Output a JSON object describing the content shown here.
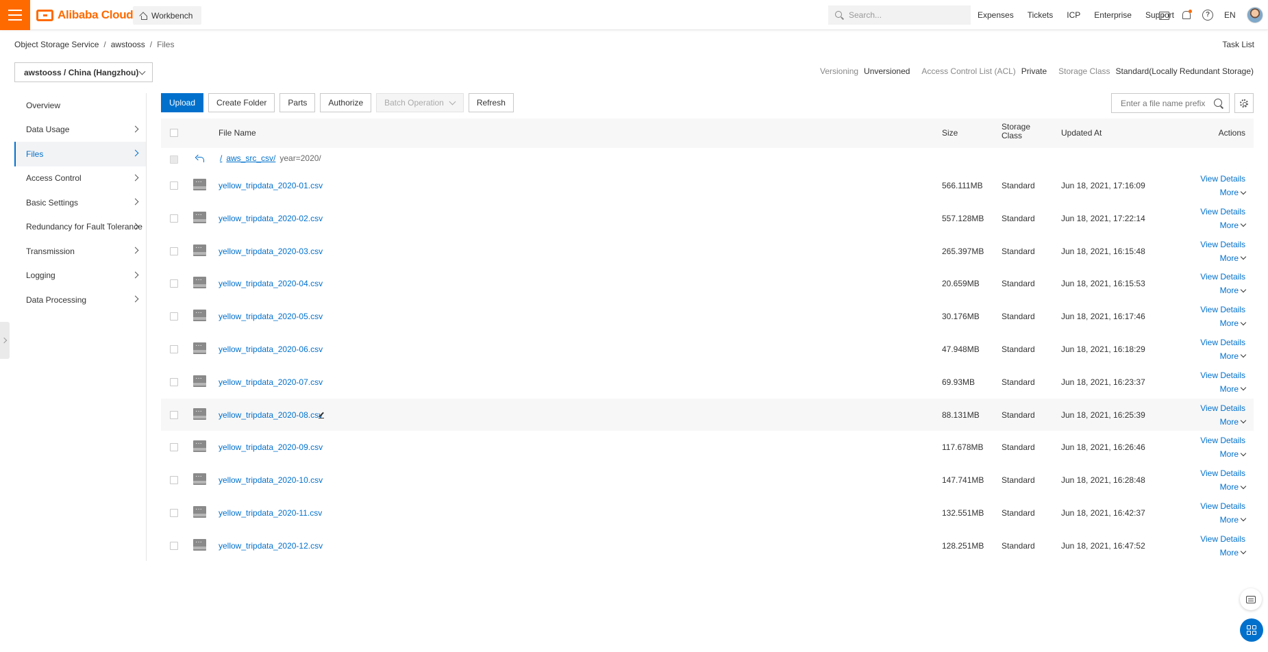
{
  "header": {
    "brand": "Alibaba Cloud",
    "workbench": "Workbench",
    "search_placeholder": "Search...",
    "links": [
      "Expenses",
      "Tickets",
      "ICP",
      "Enterprise",
      "Support"
    ],
    "help": "?",
    "lang": "EN"
  },
  "breadcrumb": [
    "Object Storage Service",
    "awstooss",
    "Files"
  ],
  "breadcrumb_sep": "/",
  "task_list": "Task List",
  "bucket": "awstooss / China (Hangzhou)",
  "meta": {
    "versioning_label": "Versioning",
    "versioning_value": "Unversioned",
    "acl_label": "Access Control List (ACL)",
    "acl_value": "Private",
    "storage_label": "Storage Class",
    "storage_value": "Standard(Locally Redundant Storage)"
  },
  "sidebar": [
    {
      "label": "Overview",
      "chevron": false,
      "active": false
    },
    {
      "label": "Data Usage",
      "chevron": true,
      "active": false
    },
    {
      "label": "Files",
      "chevron": true,
      "active": true
    },
    {
      "label": "Access Control",
      "chevron": true,
      "active": false
    },
    {
      "label": "Basic Settings",
      "chevron": true,
      "active": false
    },
    {
      "label": "Redundancy for Fault Tolerance",
      "chevron": true,
      "active": false
    },
    {
      "label": "Transmission",
      "chevron": true,
      "active": false
    },
    {
      "label": "Logging",
      "chevron": true,
      "active": false
    },
    {
      "label": "Data Processing",
      "chevron": true,
      "active": false
    }
  ],
  "toolbar": {
    "upload": "Upload",
    "create_folder": "Create Folder",
    "parts": "Parts",
    "authorize": "Authorize",
    "batch": "Batch Operation",
    "refresh": "Refresh",
    "prefix_placeholder": "Enter a file name prefix"
  },
  "table": {
    "headers": {
      "name": "File Name",
      "size": "Size",
      "storage": "Storage Class",
      "updated": "Updated At",
      "actions": "Actions"
    },
    "path_root": "/",
    "path_link": "aws_src_csv/",
    "path_current": "year=2020/",
    "view_details": "View Details",
    "more": "More",
    "rows": [
      {
        "name": "yellow_tripdata_2020-01.csv",
        "size": "566.111MB",
        "storage": "Standard",
        "updated": "Jun 18, 2021, 17:16:09"
      },
      {
        "name": "yellow_tripdata_2020-02.csv",
        "size": "557.128MB",
        "storage": "Standard",
        "updated": "Jun 18, 2021, 17:22:14"
      },
      {
        "name": "yellow_tripdata_2020-03.csv",
        "size": "265.397MB",
        "storage": "Standard",
        "updated": "Jun 18, 2021, 16:15:48"
      },
      {
        "name": "yellow_tripdata_2020-04.csv",
        "size": "20.659MB",
        "storage": "Standard",
        "updated": "Jun 18, 2021, 16:15:53"
      },
      {
        "name": "yellow_tripdata_2020-05.csv",
        "size": "30.176MB",
        "storage": "Standard",
        "updated": "Jun 18, 2021, 16:17:46"
      },
      {
        "name": "yellow_tripdata_2020-06.csv",
        "size": "47.948MB",
        "storage": "Standard",
        "updated": "Jun 18, 2021, 16:18:29"
      },
      {
        "name": "yellow_tripdata_2020-07.csv",
        "size": "69.93MB",
        "storage": "Standard",
        "updated": "Jun 18, 2021, 16:23:37"
      },
      {
        "name": "yellow_tripdata_2020-08.csv",
        "size": "88.131MB",
        "storage": "Standard",
        "updated": "Jun 18, 2021, 16:25:39",
        "hover": true
      },
      {
        "name": "yellow_tripdata_2020-09.csv",
        "size": "117.678MB",
        "storage": "Standard",
        "updated": "Jun 18, 2021, 16:26:46"
      },
      {
        "name": "yellow_tripdata_2020-10.csv",
        "size": "147.741MB",
        "storage": "Standard",
        "updated": "Jun 18, 2021, 16:28:48"
      },
      {
        "name": "yellow_tripdata_2020-11.csv",
        "size": "132.551MB",
        "storage": "Standard",
        "updated": "Jun 18, 2021, 16:42:37"
      },
      {
        "name": "yellow_tripdata_2020-12.csv",
        "size": "128.251MB",
        "storage": "Standard",
        "updated": "Jun 18, 2021, 16:47:52"
      }
    ]
  },
  "colors": {
    "brand": "#ff6a00",
    "link": "#0070cc"
  }
}
